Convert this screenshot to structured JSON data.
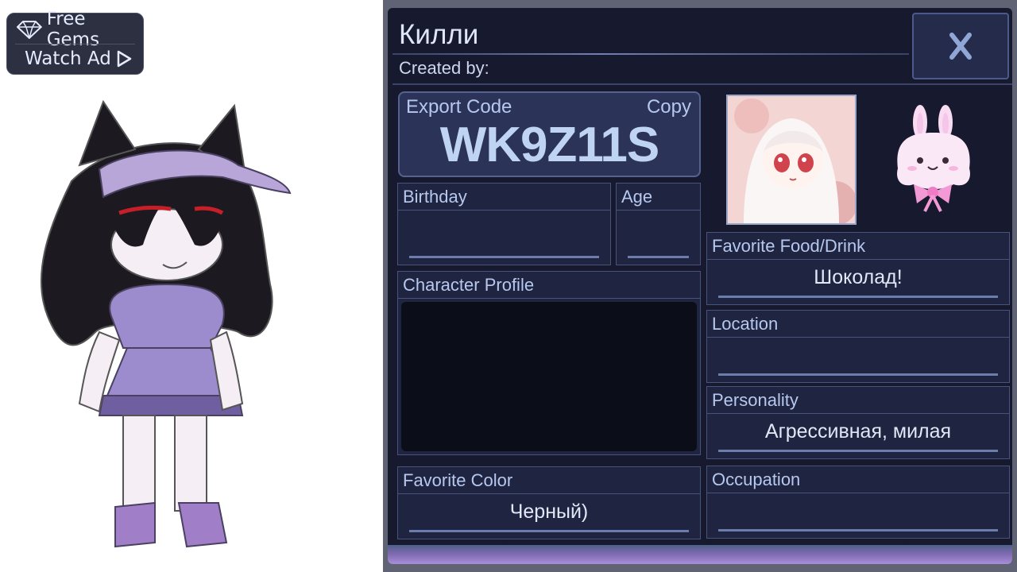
{
  "ad_button": {
    "free_gems": "Free Gems",
    "watch_ad": "Watch Ad"
  },
  "profile": {
    "name": "Килли",
    "created_by": "Created by:",
    "close_label": "X",
    "export_label": "Export Code",
    "copy_label": "Copy",
    "export_code": "WK9Z11S",
    "birthday_label": "Birthday",
    "birthday_value": "",
    "age_label": "Age",
    "age_value": "",
    "character_profile_label": "Character Profile",
    "character_profile_value": "",
    "favorite_color_label": "Favorite Color",
    "favorite_color_value": "Черный)",
    "favorite_food_label": "Favorite Food/Drink",
    "favorite_food_value": "Шоколад!",
    "location_label": "Location",
    "location_value": "",
    "personality_label": "Personality",
    "personality_value": "Агрессивная, милая",
    "occupation_label": "Occupation",
    "occupation_value": ""
  },
  "icons": {
    "gem": "gem-icon",
    "play": "play-icon",
    "close": "close-icon",
    "bunny": "bunny-icon"
  },
  "colors": {
    "panel_bg": "#171a2f",
    "box_bg": "#1f2440",
    "label": "#b7c8ef",
    "accent": "#6a7dac"
  }
}
